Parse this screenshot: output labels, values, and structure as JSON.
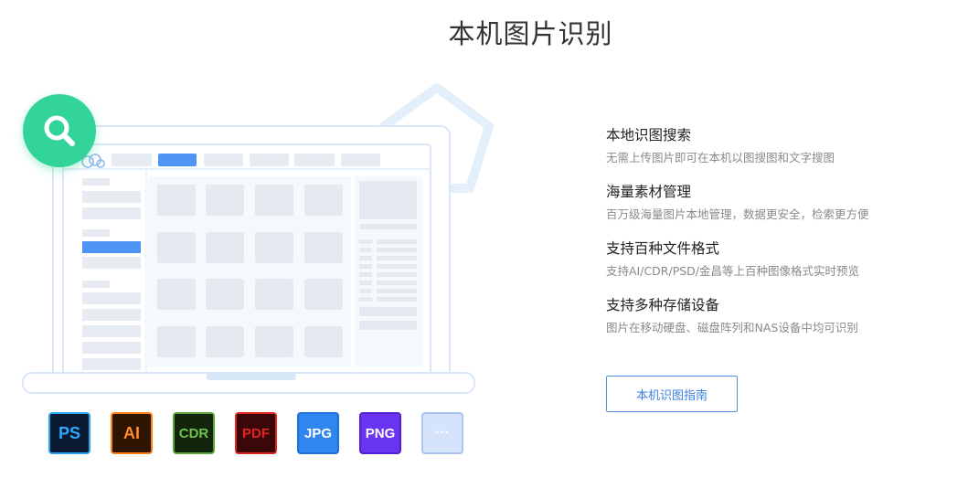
{
  "page": {
    "title": "本机图片识别"
  },
  "features": [
    {
      "title": "本地识图搜索",
      "desc": "无需上传图片即可在本机以图搜图和文字搜图"
    },
    {
      "title": "海量素材管理",
      "desc": "百万级海量图片本地管理，数据更安全，检索更方便"
    },
    {
      "title": "支持百种文件格式",
      "desc": "支持AI/CDR/PSD/金昌等上百种图像格式实时预览"
    },
    {
      "title": "支持多种存储设备",
      "desc": "图片在移动硬盘、磁盘阵列和NAS设备中均可识别"
    }
  ],
  "guide_button": {
    "label": "本机识图指南"
  },
  "formats": [
    {
      "label": "PS",
      "icon": "photoshop-icon",
      "bg": "#0a1a33",
      "border": "#2aa4f4",
      "color": "#31a8ff"
    },
    {
      "label": "AI",
      "icon": "illustrator-icon",
      "bg": "#2e1500",
      "border": "#ff7f18",
      "color": "#ff8a2a"
    },
    {
      "label": "CDR",
      "icon": "coreldraw-icon",
      "bg": "#12240c",
      "border": "#5aa63a",
      "color": "#6ec24a"
    },
    {
      "label": "PDF",
      "icon": "pdf-icon",
      "bg": "#3a0808",
      "border": "#e0261f",
      "color": "#e0261f"
    },
    {
      "label": "JPG",
      "icon": "jpg-icon",
      "bg": "#2f86ef",
      "border": "#1f6fd6",
      "color": "#ffffff"
    },
    {
      "label": "PNG",
      "icon": "png-icon",
      "bg": "#6a35f0",
      "border": "#5224d0",
      "color": "#ffffff"
    },
    {
      "label": "···",
      "icon": "more-icon",
      "bg": "#d5e3fb",
      "border": "#a9c4f2",
      "color": "#ffffff"
    }
  ],
  "colors": {
    "accent": "#4f90e6",
    "search_badge": "#33d49a",
    "illustration_line": "#d6e6f8"
  }
}
